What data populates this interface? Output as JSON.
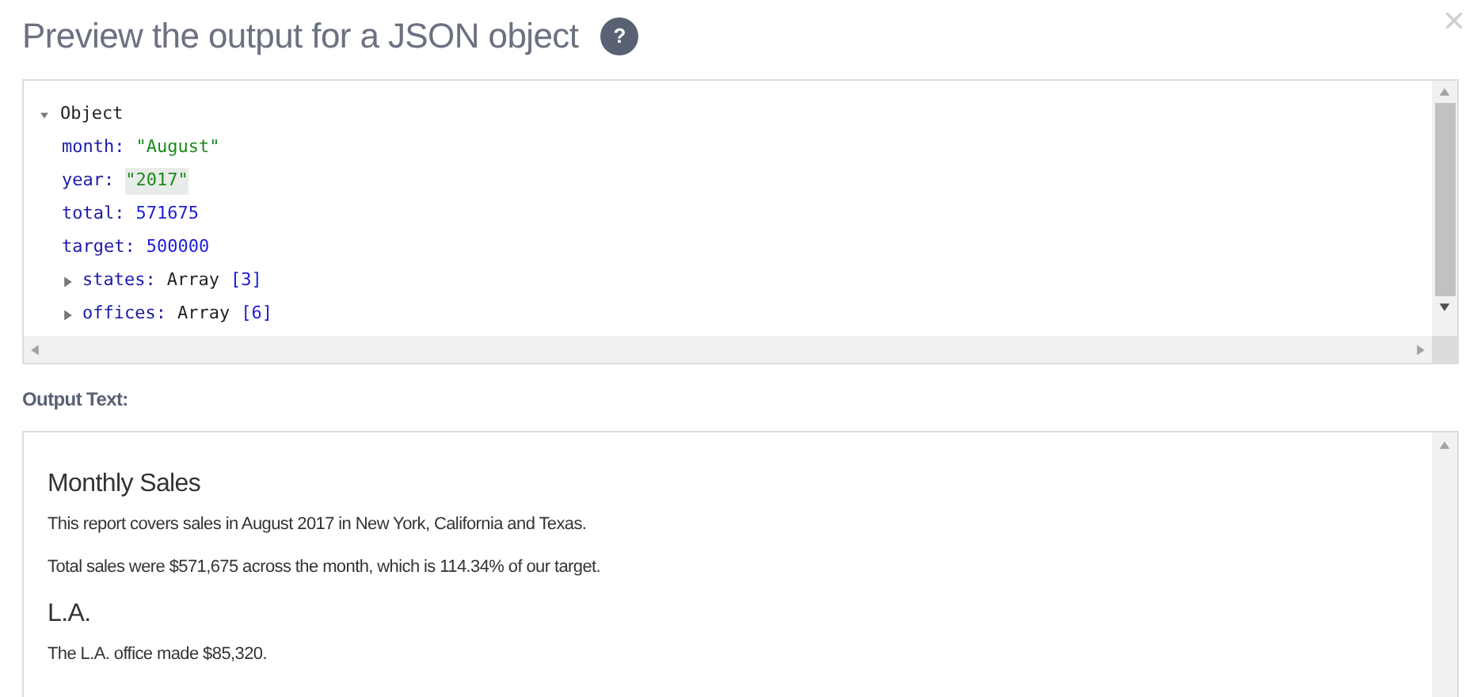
{
  "dialog": {
    "title": "Preview the output for a JSON object",
    "help_label": "?",
    "close_label": "×"
  },
  "json_tree": {
    "label": "Object",
    "expanded": true,
    "properties": [
      {
        "key": "month:",
        "kind": "string",
        "value": "\"August\"",
        "selected": false
      },
      {
        "key": "year:",
        "kind": "string",
        "value": "\"2017\"",
        "selected": true
      },
      {
        "key": "total:",
        "kind": "number",
        "value": "571675",
        "selected": false
      },
      {
        "key": "target:",
        "kind": "number",
        "value": "500000",
        "selected": false
      },
      {
        "key": "states:",
        "kind": "array",
        "type_label": "Array",
        "count": "[3]",
        "expanded": false,
        "selected": false
      },
      {
        "key": "offices:",
        "kind": "array",
        "type_label": "Array",
        "count": "[6]",
        "expanded": false,
        "selected": false
      }
    ]
  },
  "output": {
    "label": "Output Text:",
    "blocks": [
      {
        "kind": "heading",
        "text": "Monthly Sales"
      },
      {
        "kind": "paragraph",
        "text": "This report covers sales in August 2017 in New York, California and Texas."
      },
      {
        "kind": "paragraph",
        "text": "Total sales were $571,675 across the month, which is 114.34% of our target."
      },
      {
        "kind": "heading",
        "text": "L.A."
      },
      {
        "kind": "paragraph",
        "text": "The L.A. office made $85,320."
      }
    ]
  }
}
